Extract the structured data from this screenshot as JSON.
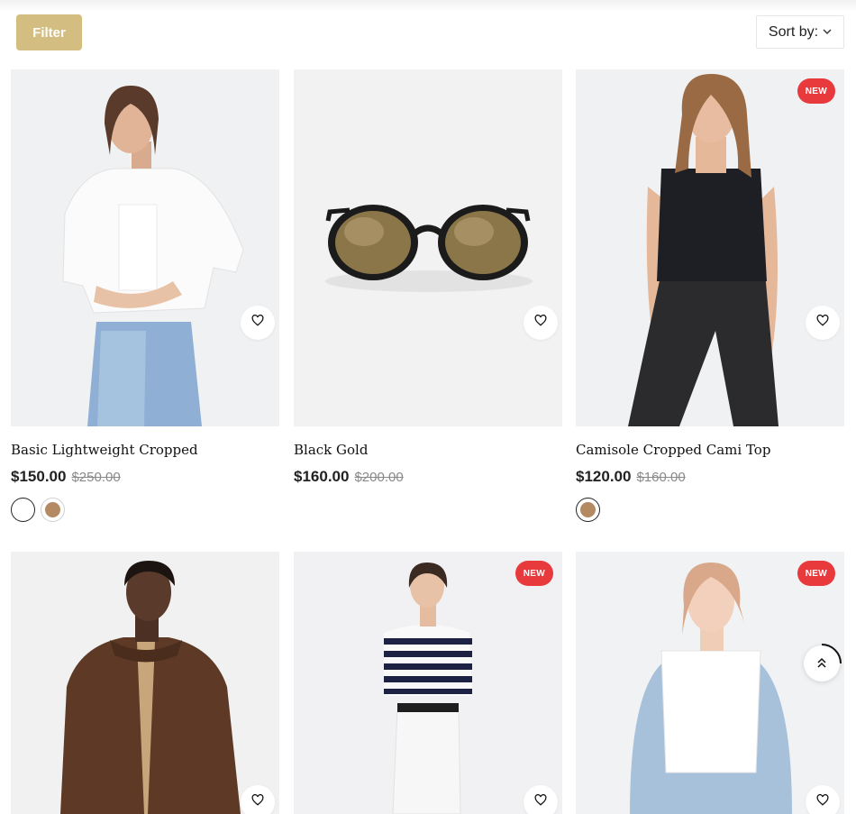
{
  "toolbar": {
    "filter_label": "Filter",
    "sort_label": "Sort by:"
  },
  "icons": {
    "wishlist": "heart-icon",
    "sort": "chevron-down-icon",
    "scroll_top": "double-chevron-up-icon"
  },
  "colors": {
    "accent": "#d4bd80",
    "badge": "#e83a3d",
    "image_bg": "#f0f1f3"
  },
  "products": [
    {
      "title": "Basic Lightweight Cropped",
      "price": "$150.00",
      "old_price": "$250.00",
      "badge": "",
      "swatches": [
        {
          "color": "#ffffff",
          "active": true
        },
        {
          "color": "#b48a62",
          "active": false
        }
      ]
    },
    {
      "title": "Black Gold",
      "price": "$160.00",
      "old_price": "$200.00",
      "badge": "",
      "swatches": []
    },
    {
      "title": "Camisole Cropped Cami Top",
      "price": "$120.00",
      "old_price": "$160.00",
      "badge": "NEW",
      "swatches": [
        {
          "color": "#b48a62",
          "active": true
        }
      ]
    },
    {
      "title": "",
      "price": "",
      "old_price": "",
      "badge": "",
      "swatches": []
    },
    {
      "title": "",
      "price": "",
      "old_price": "",
      "badge": "NEW",
      "swatches": []
    },
    {
      "title": "",
      "price": "",
      "old_price": "",
      "badge": "NEW",
      "swatches": []
    }
  ]
}
